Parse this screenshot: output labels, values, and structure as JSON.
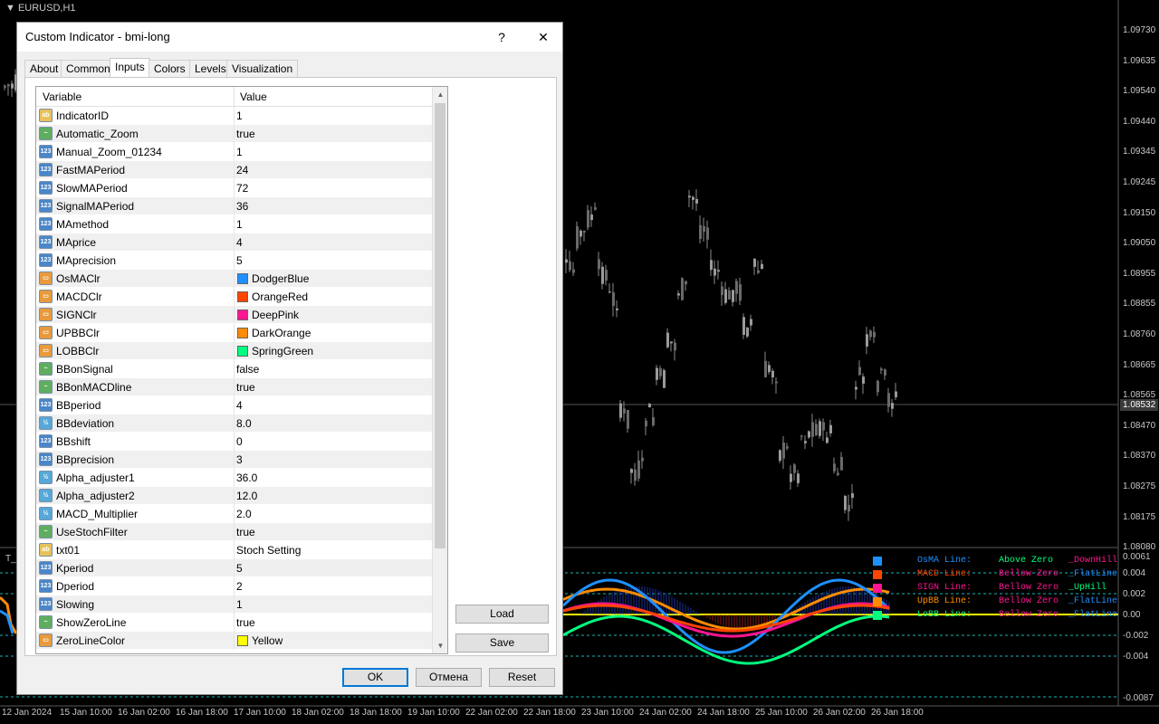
{
  "chart": {
    "symbol": "EURUSD,H1",
    "subwindow_title": "T_",
    "price_labels": [
      "1.09730",
      "1.09635",
      "1.09540",
      "1.09440",
      "1.09345",
      "1.09245",
      "1.09150",
      "1.09050",
      "1.08955",
      "1.08855",
      "1.08760",
      "1.08665",
      "1.08565",
      "1.08470",
      "1.08370",
      "1.08275",
      "1.08175",
      "1.08080"
    ],
    "current_price": "1.08532",
    "sub_labels": [
      "0.0061",
      "0.004",
      "0.002",
      "0.00",
      "-0.002",
      "-0.004",
      "-0.0087"
    ],
    "time_labels": [
      "12 Jan 2024",
      "15 Jan 10:00",
      "16 Jan 02:00",
      "16 Jan 18:00",
      "17 Jan 10:00",
      "18 Jan 02:00",
      "18 Jan 18:00",
      "19 Jan 10:00",
      "22 Jan 02:00",
      "22 Jan 18:00",
      "23 Jan 10:00",
      "24 Jan 02:00",
      "24 Jan 18:00",
      "25 Jan 10:00",
      "26 Jan 02:00",
      "26 Jan 18:00"
    ],
    "legend": [
      {
        "name": "OsMA Line:",
        "state": "Above Zero",
        "trend": "_DownHill",
        "color": "#1E90FF",
        "name_color": "#1E90FF",
        "state_color": "#00FF7F",
        "trend_color": "#FF1493"
      },
      {
        "name": "MACD Line:",
        "state": "Bellow Zero",
        "trend": "_FlatLine",
        "color": "#FF4500",
        "name_color": "#FF4500",
        "state_color": "#FF1493",
        "trend_color": "#1E90FF"
      },
      {
        "name": "SIGN Line:",
        "state": "Bellow Zero",
        "trend": "_UpHill",
        "color": "#FF1493",
        "name_color": "#FF1493",
        "state_color": "#FF1493",
        "trend_color": "#00FF7F"
      },
      {
        "name": "UpBB Line:",
        "state": "Bellow Zero",
        "trend": "_FlatLine",
        "color": "#FF8C00",
        "name_color": "#FF8C00",
        "state_color": "#FF1493",
        "trend_color": "#1E90FF"
      },
      {
        "name": "LoBB Line:",
        "state": "Bellow Zero",
        "trend": "_FlatLine",
        "color": "#00FF7F",
        "name_color": "#00FF7F",
        "state_color": "#FF1493",
        "trend_color": "#1E90FF"
      }
    ]
  },
  "dialog": {
    "title": "Custom Indicator - bmi-long",
    "help_label": "?",
    "close_label": "✕",
    "tabs": [
      "About",
      "Common",
      "Inputs",
      "Colors",
      "Levels",
      "Visualization"
    ],
    "active_tab": "Inputs",
    "columns": {
      "variable": "Variable",
      "value": "Value"
    },
    "rows": [
      {
        "icon": "ab",
        "var": "IndicatorID",
        "value": "1"
      },
      {
        "icon": "bool",
        "var": "Automatic_Zoom",
        "value": "true"
      },
      {
        "icon": "123",
        "var": "Manual_Zoom_01234",
        "value": "1"
      },
      {
        "icon": "123",
        "var": "FastMAPeriod",
        "value": "24"
      },
      {
        "icon": "123",
        "var": "SlowMAPeriod",
        "value": "72"
      },
      {
        "icon": "123",
        "var": "SignalMAPeriod",
        "value": "36"
      },
      {
        "icon": "123",
        "var": "MAmethod",
        "value": "1"
      },
      {
        "icon": "123",
        "var": "MAprice",
        "value": "4"
      },
      {
        "icon": "123",
        "var": "MAprecision",
        "value": "5"
      },
      {
        "icon": "color",
        "var": "OsMAClr",
        "value": "DodgerBlue",
        "color": "#1E90FF"
      },
      {
        "icon": "color",
        "var": "MACDClr",
        "value": "OrangeRed",
        "color": "#FF4500"
      },
      {
        "icon": "color",
        "var": "SIGNClr",
        "value": "DeepPink",
        "color": "#FF1493"
      },
      {
        "icon": "color",
        "var": "UPBBClr",
        "value": "DarkOrange",
        "color": "#FF8C00"
      },
      {
        "icon": "color",
        "var": "LOBBClr",
        "value": "SpringGreen",
        "color": "#00FF7F"
      },
      {
        "icon": "bool",
        "var": "BBonSignal",
        "value": "false"
      },
      {
        "icon": "bool",
        "var": "BBonMACDline",
        "value": "true"
      },
      {
        "icon": "123",
        "var": "BBperiod",
        "value": "4"
      },
      {
        "icon": "half",
        "var": "BBdeviation",
        "value": "8.0"
      },
      {
        "icon": "123",
        "var": "BBshift",
        "value": "0"
      },
      {
        "icon": "123",
        "var": "BBprecision",
        "value": "3"
      },
      {
        "icon": "half",
        "var": "Alpha_adjuster1",
        "value": "36.0"
      },
      {
        "icon": "half",
        "var": "Alpha_adjuster2",
        "value": "12.0"
      },
      {
        "icon": "half",
        "var": "MACD_Multiplier",
        "value": "2.0"
      },
      {
        "icon": "bool",
        "var": "UseStochFilter",
        "value": "true"
      },
      {
        "icon": "ab",
        "var": "txt01",
        "value": "Stoch Setting"
      },
      {
        "icon": "123",
        "var": "Kperiod",
        "value": "5"
      },
      {
        "icon": "123",
        "var": "Dperiod",
        "value": "2"
      },
      {
        "icon": "123",
        "var": "Slowing",
        "value": "1"
      },
      {
        "icon": "bool",
        "var": "ShowZeroLine",
        "value": "true"
      },
      {
        "icon": "color",
        "var": "ZeroLineColor",
        "value": "Yellow",
        "color": "#FFFF00"
      }
    ],
    "buttons": {
      "load": "Load",
      "save": "Save",
      "ok": "OK",
      "cancel": "Отмена",
      "reset": "Reset"
    }
  }
}
